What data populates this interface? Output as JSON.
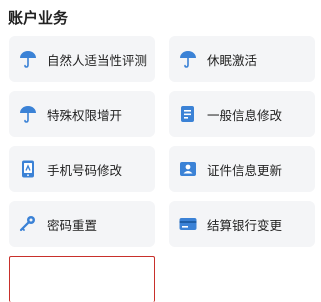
{
  "section": {
    "title": "账户业务"
  },
  "colors": {
    "icon_blue": "#3b82d6",
    "card_bg": "#f4f5f7",
    "highlight_border": "#c8302b"
  },
  "items": [
    {
      "label": "自然人适当性评测",
      "icon": "umbrella-icon"
    },
    {
      "label": "休眠激活",
      "icon": "umbrella-icon"
    },
    {
      "label": "特殊权限增开",
      "icon": "umbrella-icon"
    },
    {
      "label": "一般信息修改",
      "icon": "document-edit-icon"
    },
    {
      "label": "手机号码修改",
      "icon": "phone-icon"
    },
    {
      "label": "证件信息更新",
      "icon": "id-card-icon"
    },
    {
      "label": "密码重置",
      "icon": "key-icon"
    },
    {
      "label": "结算银行变更",
      "icon": "bank-card-icon"
    },
    {
      "label": "",
      "icon": ""
    }
  ]
}
